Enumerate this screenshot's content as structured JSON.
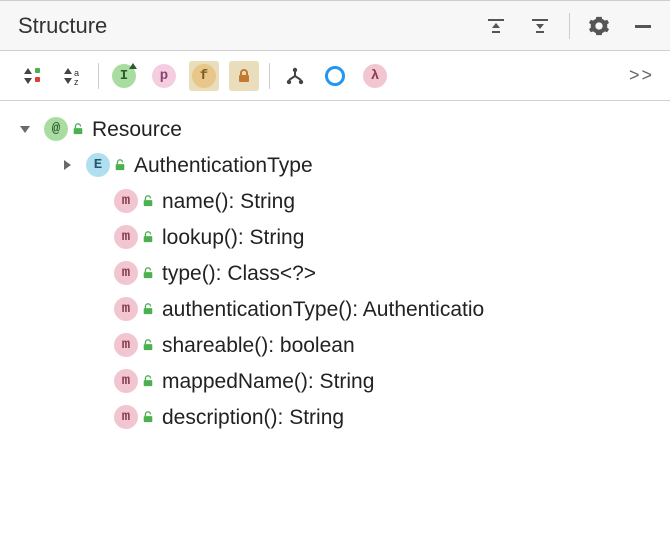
{
  "panel": {
    "title": "Structure"
  },
  "toolbar": {
    "sort_visibility_icon": "sort-visibility",
    "sort_alpha_icon": "sort-alpha",
    "filter_class": "I",
    "filter_package": "p",
    "filter_field": "f",
    "filter_lock": "lock",
    "filter_inherited": "fork",
    "filter_ring": "ring",
    "filter_lambda": "λ",
    "overflow": ">>"
  },
  "tree": {
    "root": {
      "badge": "@",
      "label": "Resource",
      "expanded": true
    },
    "children": [
      {
        "badge": "E",
        "label": "AuthenticationType",
        "expandable": true
      },
      {
        "badge": "m",
        "label": "name(): String"
      },
      {
        "badge": "m",
        "label": "lookup(): String"
      },
      {
        "badge": "m",
        "label": "type(): Class<?>"
      },
      {
        "badge": "m",
        "label": "authenticationType(): Authenticatio"
      },
      {
        "badge": "m",
        "label": "shareable(): boolean"
      },
      {
        "badge": "m",
        "label": "mappedName(): String"
      },
      {
        "badge": "m",
        "label": "description(): String"
      }
    ]
  }
}
